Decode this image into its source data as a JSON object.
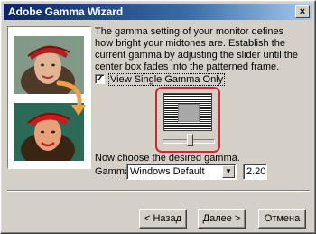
{
  "window": {
    "title": "Adobe Gamma Wizard",
    "close_glyph": "×"
  },
  "description": "The gamma setting of your monitor defines how bright your midtones are. Establish the current gamma by adjusting the slider until the center box fades into the patterned frame.",
  "single_gamma": {
    "label": "View Single Gamma Only",
    "checked": true,
    "check_glyph": "✓"
  },
  "gamma_slider": {
    "level": 0.55
  },
  "choose_text": "Now choose the desired gamma.",
  "gamma": {
    "label": "Gamma:",
    "selected": "Windows Default",
    "value": "2.20"
  },
  "buttons": {
    "back": "< Назад",
    "next": "Далее >",
    "cancel": "Отмена"
  },
  "colors": {
    "highlight_ring": "#d8242c",
    "title_bar": "#0a246a"
  }
}
